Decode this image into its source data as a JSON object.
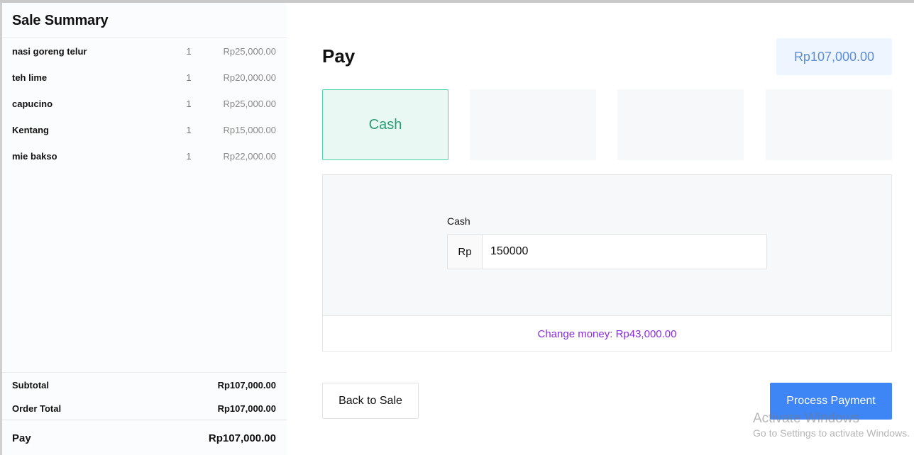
{
  "sidebar": {
    "title": "Sale Summary",
    "items": [
      {
        "name": "nasi goreng telur",
        "qty": "1",
        "price": "Rp25,000.00"
      },
      {
        "name": "teh lime",
        "qty": "1",
        "price": "Rp20,000.00"
      },
      {
        "name": "capucino",
        "qty": "1",
        "price": "Rp25,000.00"
      },
      {
        "name": "Kentang",
        "qty": "1",
        "price": "Rp15,000.00"
      },
      {
        "name": "mie bakso",
        "qty": "1",
        "price": "Rp22,000.00"
      }
    ],
    "subtotal_label": "Subtotal",
    "subtotal_value": "Rp107,000.00",
    "order_total_label": "Order Total",
    "order_total_value": "Rp107,000.00",
    "pay_label": "Pay",
    "pay_value": "Rp107,000.00"
  },
  "main": {
    "title": "Pay",
    "amount_due": "Rp107,000.00",
    "payment_methods": [
      {
        "label": "Cash",
        "selected": true
      },
      {
        "label": "",
        "selected": false
      },
      {
        "label": "",
        "selected": false
      },
      {
        "label": "",
        "selected": false
      }
    ],
    "cash_label": "Cash",
    "currency_prefix": "Rp",
    "cash_input_value": "150000",
    "change_text": "Change money: Rp43,000.00",
    "back_button": "Back to Sale",
    "process_button": "Process Payment"
  },
  "watermark": {
    "line1": "Activate Windows",
    "line2": "Go to Settings to activate Windows."
  },
  "colors": {
    "accent_blue": "#3e86f5",
    "cash_green": "#2a9d78",
    "change_purple": "#8a2be2",
    "amount_blue": "#5b8dd9"
  }
}
